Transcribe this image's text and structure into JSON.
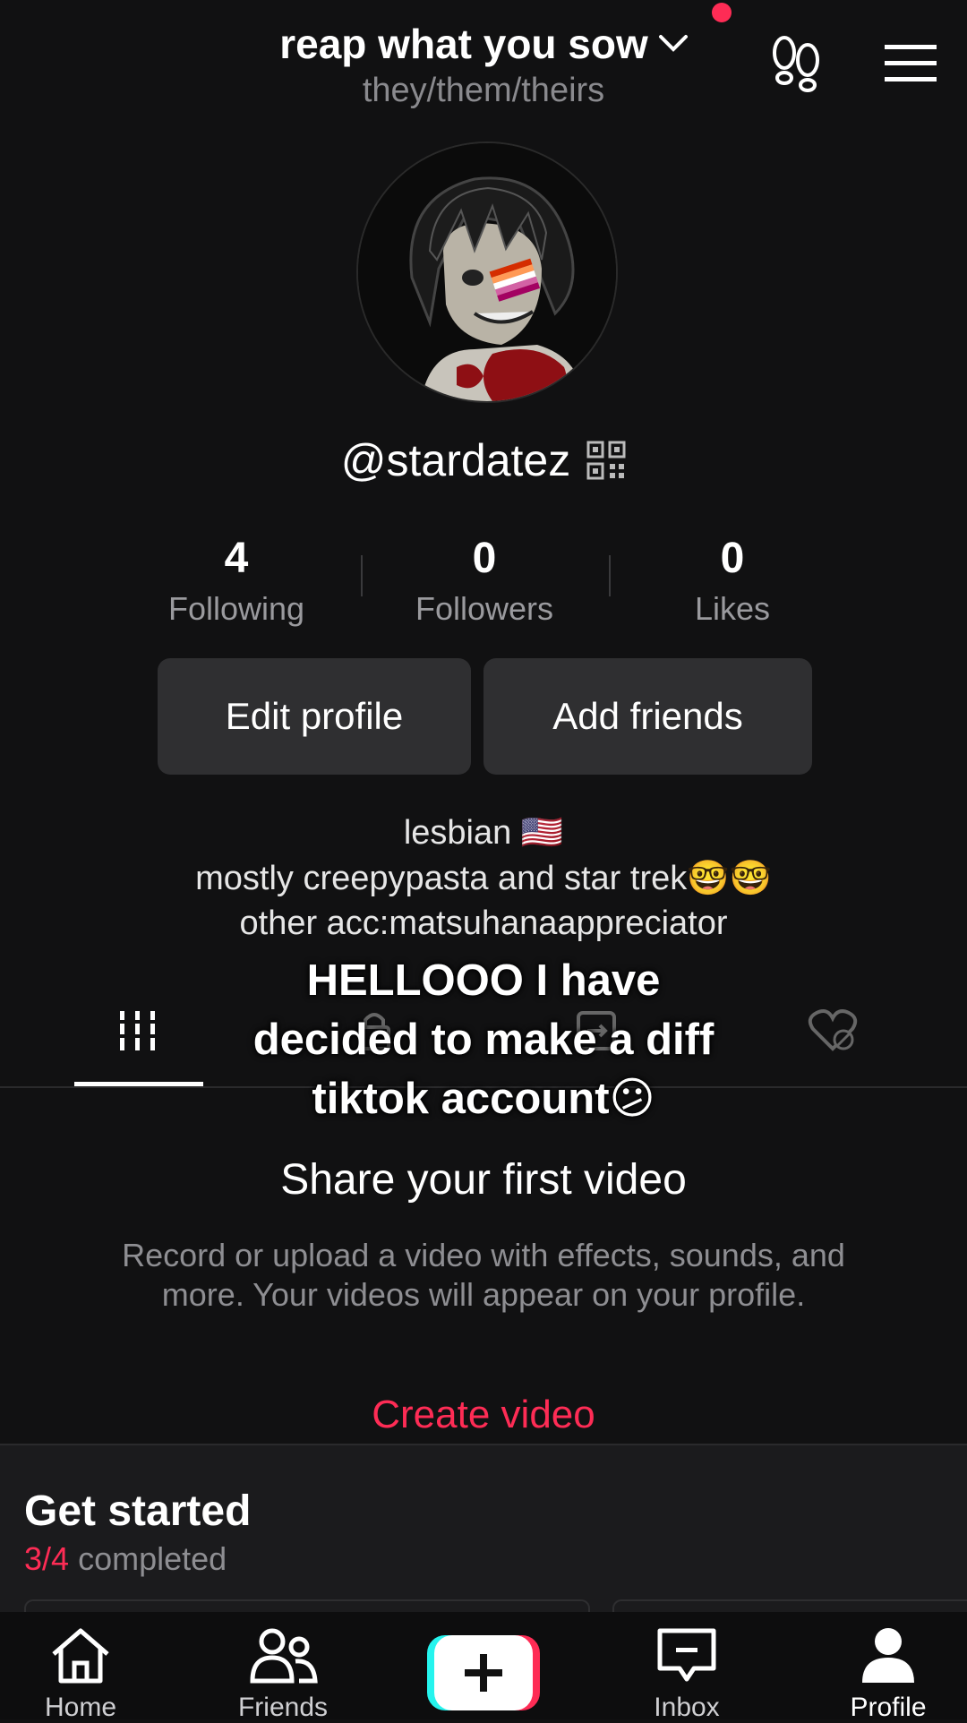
{
  "header": {
    "title": "reap what you sow",
    "pronouns": "they/them/theirs"
  },
  "profile": {
    "username": "@stardatez",
    "stats": [
      {
        "value": "4",
        "label": "Following"
      },
      {
        "value": "0",
        "label": "Followers"
      },
      {
        "value": "0",
        "label": "Likes"
      }
    ],
    "edit_label": "Edit profile",
    "add_friends_label": "Add friends",
    "bio": [
      "lesbian 🇺🇸",
      "mostly creepypasta and star trek🤓🤓",
      "other acc:matsuhanaappreciator"
    ]
  },
  "overlay_caption": [
    "HELLOOO I have",
    "decided to make a diff",
    "tiktok account😕"
  ],
  "empty_state": {
    "title": "Share your first video",
    "description": "Record or upload a video with effects, sounds, and more. Your videos will appear on your profile.",
    "cta": "Create video"
  },
  "get_started": {
    "title": "Get started",
    "progress": "3/4",
    "progress_suffix": "completed"
  },
  "nav": [
    {
      "label": "Home",
      "icon": "home-icon"
    },
    {
      "label": "Friends",
      "icon": "friends-icon"
    },
    {
      "label": "",
      "icon": "plus-icon"
    },
    {
      "label": "Inbox",
      "icon": "inbox-icon"
    },
    {
      "label": "Profile",
      "icon": "profile-icon"
    }
  ],
  "colors": {
    "accent": "#fe2c55",
    "background": "#111112",
    "button": "#2f2f31"
  }
}
